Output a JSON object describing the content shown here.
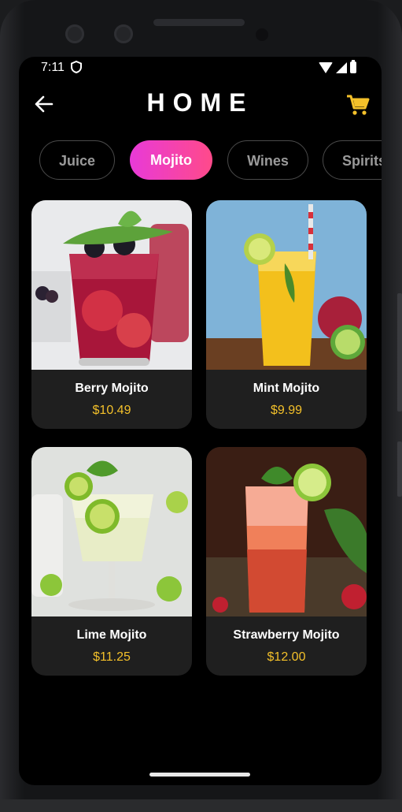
{
  "status_bar": {
    "time": "7:11"
  },
  "header": {
    "title": "HOME"
  },
  "categories": [
    {
      "label": "Juice"
    },
    {
      "label": "Mojito"
    },
    {
      "label": "Wines"
    },
    {
      "label": "Spirits"
    }
  ],
  "selected_category": "Mojito",
  "products": [
    {
      "name": "Berry Mojito",
      "price": "$10.49"
    },
    {
      "name": "Mint Mojito",
      "price": "$9.99"
    },
    {
      "name": "Lime Mojito",
      "price": "$11.25"
    },
    {
      "name": "Strawberry Mojito",
      "price": "$12.00"
    }
  ],
  "colors": {
    "accent_gradient_start": "#e83ad8",
    "accent_gradient_end": "#ff4a8a",
    "price": "#f3c02a",
    "cart": "#f3c02a"
  },
  "icons": [
    "back-arrow-icon",
    "cart-icon",
    "shield-icon",
    "wifi-icon",
    "signal-icon",
    "battery-icon"
  ]
}
